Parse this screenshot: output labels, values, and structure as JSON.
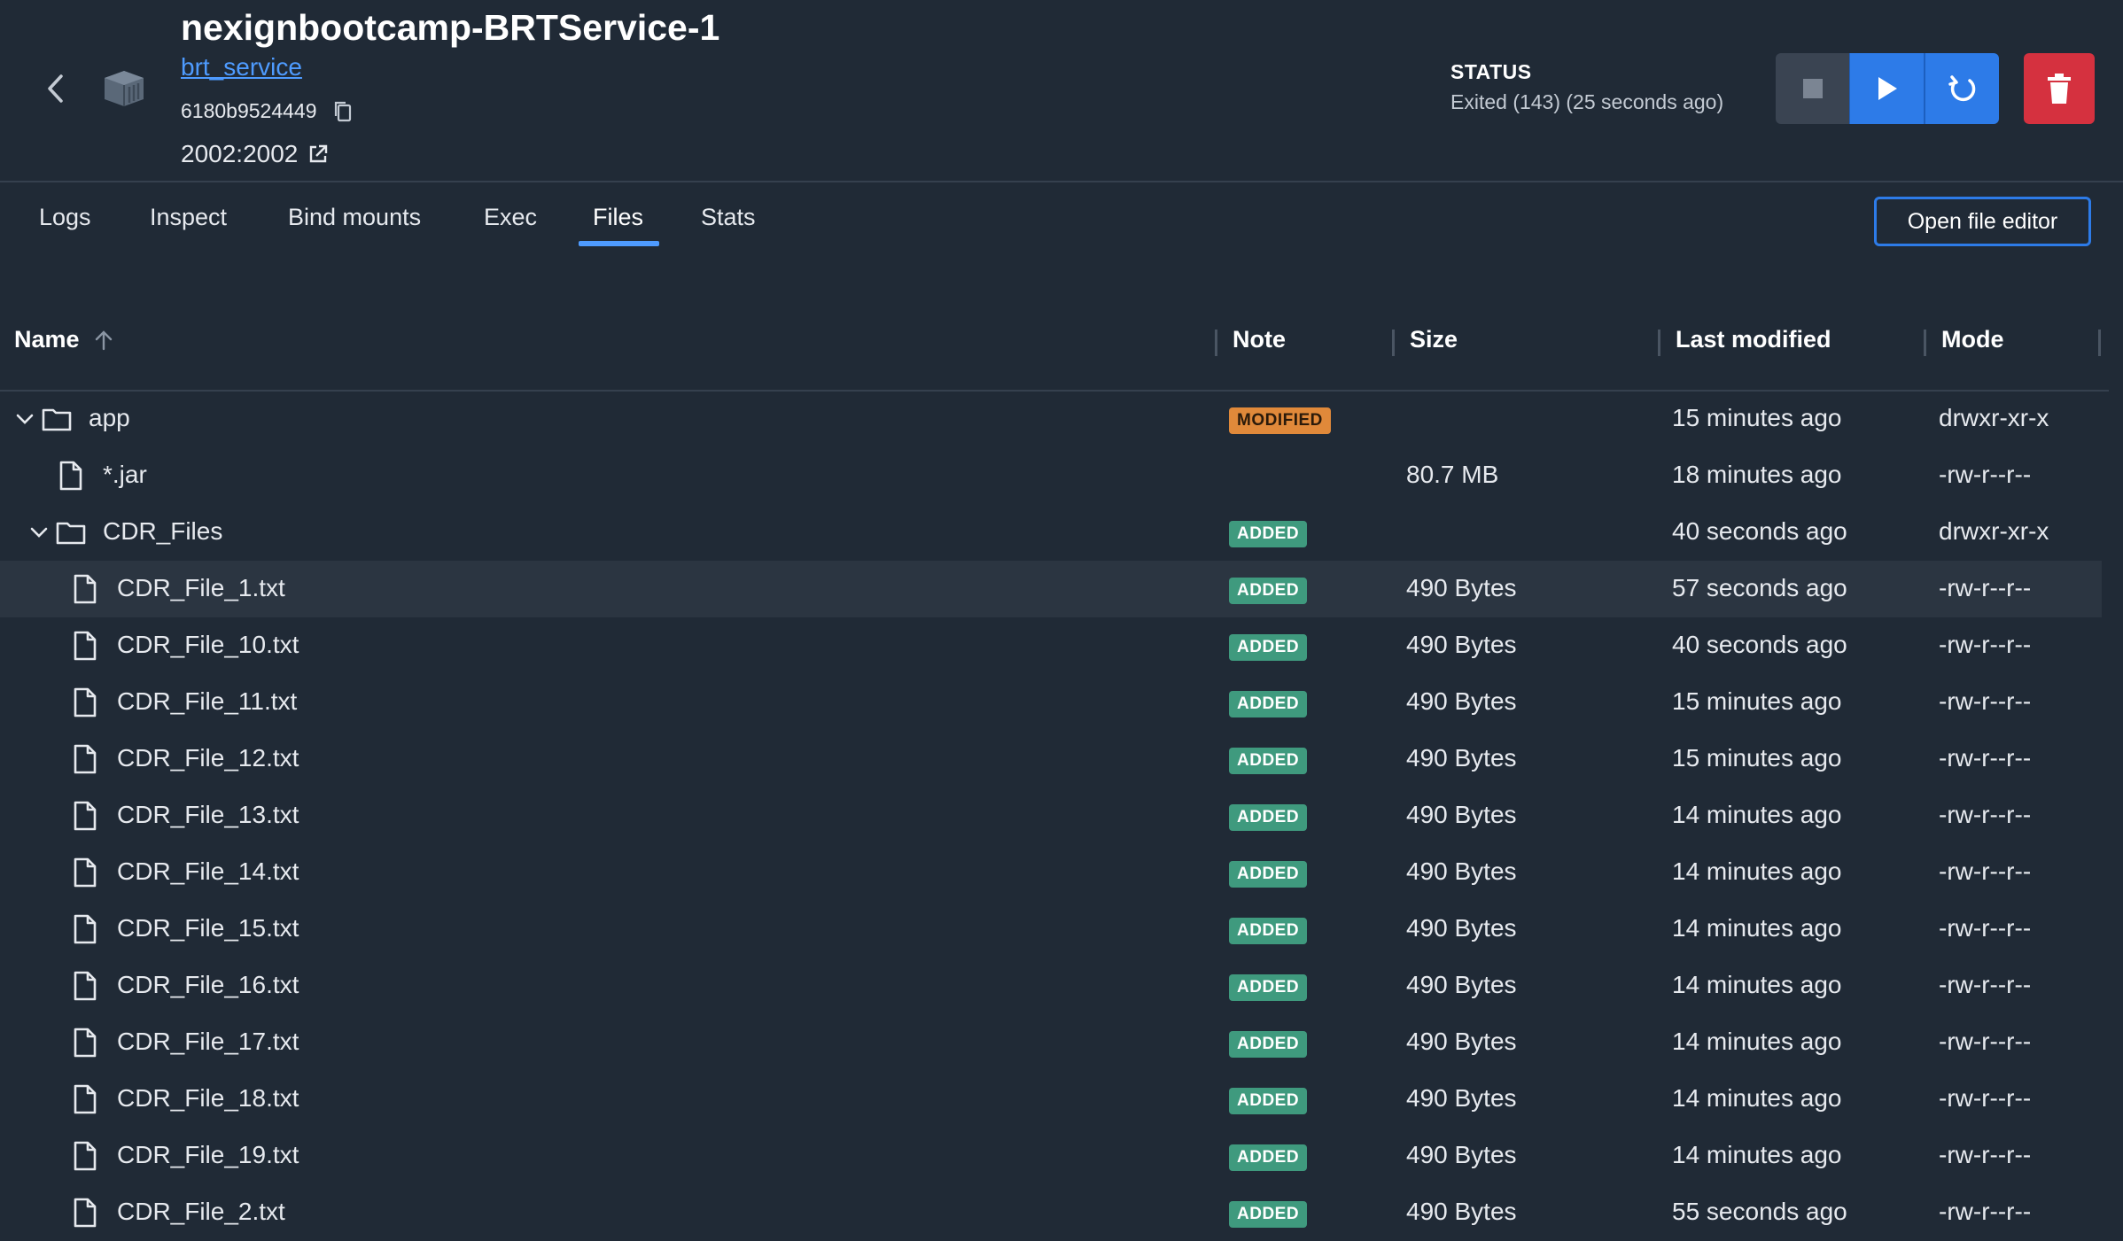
{
  "header": {
    "title": "nexignbootcamp-BRTService-1",
    "image_link": "brt_service",
    "container_id": "6180b9524449",
    "port": "2002:2002",
    "status_label": "STATUS",
    "status_text": "Exited (143) (25 seconds ago)"
  },
  "tabs": [
    {
      "label": "Logs"
    },
    {
      "label": "Inspect"
    },
    {
      "label": "Bind mounts"
    },
    {
      "label": "Exec"
    },
    {
      "label": "Files",
      "active": true
    },
    {
      "label": "Stats"
    }
  ],
  "open_editor_label": "Open file editor",
  "table": {
    "headers": {
      "name": "Name",
      "note": "Note",
      "size": "Size",
      "last_modified": "Last modified",
      "mode": "Mode"
    },
    "rows": [
      {
        "name": "app",
        "type": "folder",
        "expanded": true,
        "note": "MODIFIED",
        "size": "",
        "modified": "15 minutes ago",
        "mode": "drwxr-xr-x"
      },
      {
        "name": "*.jar",
        "type": "file",
        "note": "",
        "size": "80.7 MB",
        "modified": "18 minutes ago",
        "mode": "-rw-r--r--"
      },
      {
        "name": "CDR_Files",
        "type": "folder",
        "expanded": true,
        "note": "ADDED",
        "size": "",
        "modified": "40 seconds ago",
        "mode": "drwxr-xr-x"
      },
      {
        "name": "CDR_File_1.txt",
        "type": "file",
        "note": "ADDED",
        "size": "490 Bytes",
        "modified": "57 seconds ago",
        "mode": "-rw-r--r--",
        "highlighted": true
      },
      {
        "name": "CDR_File_10.txt",
        "type": "file",
        "note": "ADDED",
        "size": "490 Bytes",
        "modified": "40 seconds ago",
        "mode": "-rw-r--r--"
      },
      {
        "name": "CDR_File_11.txt",
        "type": "file",
        "note": "ADDED",
        "size": "490 Bytes",
        "modified": "15 minutes ago",
        "mode": "-rw-r--r--"
      },
      {
        "name": "CDR_File_12.txt",
        "type": "file",
        "note": "ADDED",
        "size": "490 Bytes",
        "modified": "15 minutes ago",
        "mode": "-rw-r--r--"
      },
      {
        "name": "CDR_File_13.txt",
        "type": "file",
        "note": "ADDED",
        "size": "490 Bytes",
        "modified": "14 minutes ago",
        "mode": "-rw-r--r--"
      },
      {
        "name": "CDR_File_14.txt",
        "type": "file",
        "note": "ADDED",
        "size": "490 Bytes",
        "modified": "14 minutes ago",
        "mode": "-rw-r--r--"
      },
      {
        "name": "CDR_File_15.txt",
        "type": "file",
        "note": "ADDED",
        "size": "490 Bytes",
        "modified": "14 minutes ago",
        "mode": "-rw-r--r--"
      },
      {
        "name": "CDR_File_16.txt",
        "type": "file",
        "note": "ADDED",
        "size": "490 Bytes",
        "modified": "14 minutes ago",
        "mode": "-rw-r--r--"
      },
      {
        "name": "CDR_File_17.txt",
        "type": "file",
        "note": "ADDED",
        "size": "490 Bytes",
        "modified": "14 minutes ago",
        "mode": "-rw-r--r--"
      },
      {
        "name": "CDR_File_18.txt",
        "type": "file",
        "note": "ADDED",
        "size": "490 Bytes",
        "modified": "14 minutes ago",
        "mode": "-rw-r--r--"
      },
      {
        "name": "CDR_File_19.txt",
        "type": "file",
        "note": "ADDED",
        "size": "490 Bytes",
        "modified": "14 minutes ago",
        "mode": "-rw-r--r--"
      },
      {
        "name": "CDR_File_2.txt",
        "type": "file",
        "note": "ADDED",
        "size": "490 Bytes",
        "modified": "55 seconds ago",
        "mode": "-rw-r--r--"
      }
    ]
  },
  "colors": {
    "background": "#202a36",
    "accent": "#2d7be8",
    "link": "#4e9bff",
    "added": "#3f9a7e",
    "modified": "#e0893a",
    "danger": "#d5313f"
  },
  "icons": {
    "back": "chevron-left-icon",
    "container": "container-cube-icon",
    "copy": "copy-icon",
    "external": "external-link-icon",
    "stop": "stop-icon",
    "start": "play-icon",
    "restart": "restart-icon",
    "delete": "trash-icon",
    "sort": "arrow-up-icon",
    "folder": "folder-icon",
    "file": "file-icon",
    "expand": "chevron-down-icon"
  }
}
